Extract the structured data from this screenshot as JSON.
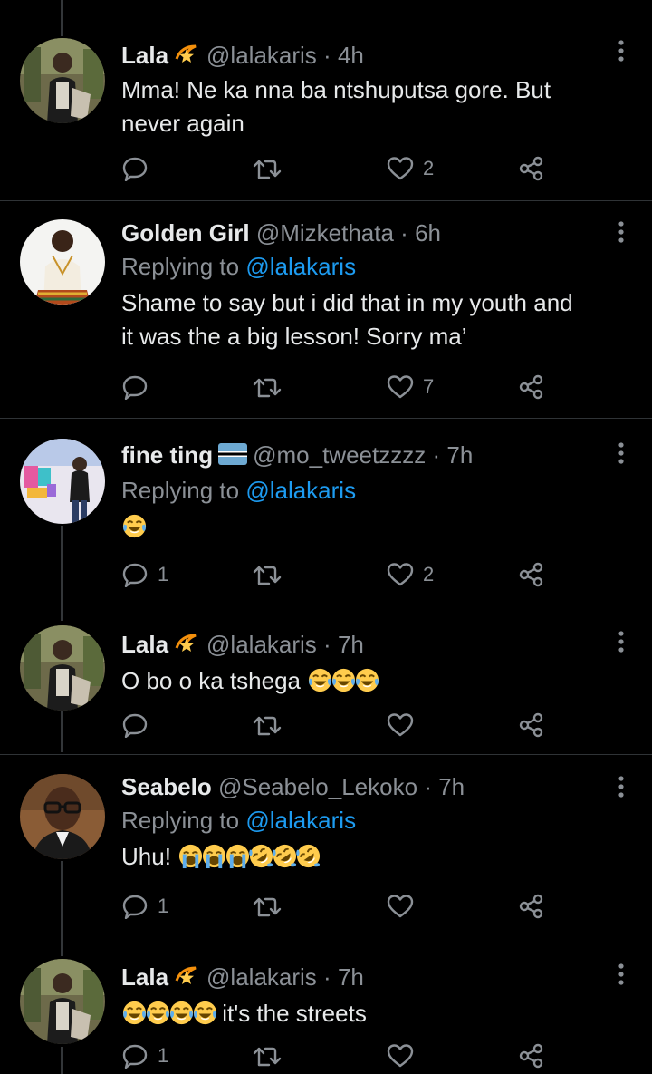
{
  "colors": {
    "background": "#000000",
    "text": "#e7e9ea",
    "muted": "#8b9096",
    "link": "#1d9bf0",
    "divider": "#2f3336"
  },
  "tweets": [
    {
      "name": "Lala",
      "badge": "dizzy-star-emoji",
      "handle": "@lalakaris",
      "dot": "·",
      "time": "4h",
      "replying_label": "",
      "replying_to": "",
      "text_lines": [
        "Mma! Ne ka nna ba ntshuputsa gore. But",
        "never again"
      ],
      "emojis": [],
      "reply_count": "",
      "like_count": "2"
    },
    {
      "name": "Golden Girl",
      "badge": "",
      "handle": "@Mizkethata",
      "dot": "·",
      "time": "6h",
      "replying_label": "Replying to",
      "replying_to": "@lalakaris",
      "text_lines": [
        "Shame to say but i did that in my youth and",
        "it was the a big lesson! Sorry ma’"
      ],
      "emojis": [],
      "reply_count": "",
      "like_count": "7"
    },
    {
      "name": "fine ting",
      "badge": "botswana-flag-emoji",
      "handle": "@mo_tweetzzzz",
      "dot": "·",
      "time": "7h",
      "replying_label": "Replying to",
      "replying_to": "@lalakaris",
      "text": "",
      "emojis": [
        "tears-of-joy"
      ],
      "reply_count": "1",
      "like_count": "2"
    },
    {
      "name": "Lala",
      "badge": "dizzy-star-emoji",
      "handle": "@lalakaris",
      "dot": "·",
      "time": "7h",
      "replying_label": "",
      "replying_to": "",
      "text": "O bo o ka tshega",
      "emojis": [
        "tears-of-joy",
        "tears-of-joy",
        "tears-of-joy"
      ],
      "reply_count": "",
      "like_count": ""
    },
    {
      "name": "Seabelo",
      "badge": "",
      "handle": "@Seabelo_Lekoko",
      "dot": "·",
      "time": "7h",
      "replying_label": "Replying to",
      "replying_to": "@lalakaris",
      "text": "Uhu!",
      "emojis": [
        "loudly-crying",
        "loudly-crying",
        "loudly-crying",
        "rolling-on-floor-laughing",
        "rolling-on-floor-laughing",
        "rolling-on-floor-laughing"
      ],
      "reply_count": "1",
      "like_count": ""
    },
    {
      "name": "Lala",
      "badge": "dizzy-star-emoji",
      "handle": "@lalakaris",
      "dot": "·",
      "time": "7h",
      "replying_label": "",
      "replying_to": "",
      "text": "it's the streets",
      "emojis": [
        "tears-of-joy",
        "tears-of-joy",
        "tears-of-joy",
        "tears-of-joy"
      ],
      "reply_count": "1",
      "like_count": ""
    }
  ],
  "icons": {
    "reply": "reply-bubble-icon",
    "retweet": "retweet-icon",
    "like": "heart-icon",
    "share": "share-icon",
    "more": "more-vertical-icon"
  }
}
